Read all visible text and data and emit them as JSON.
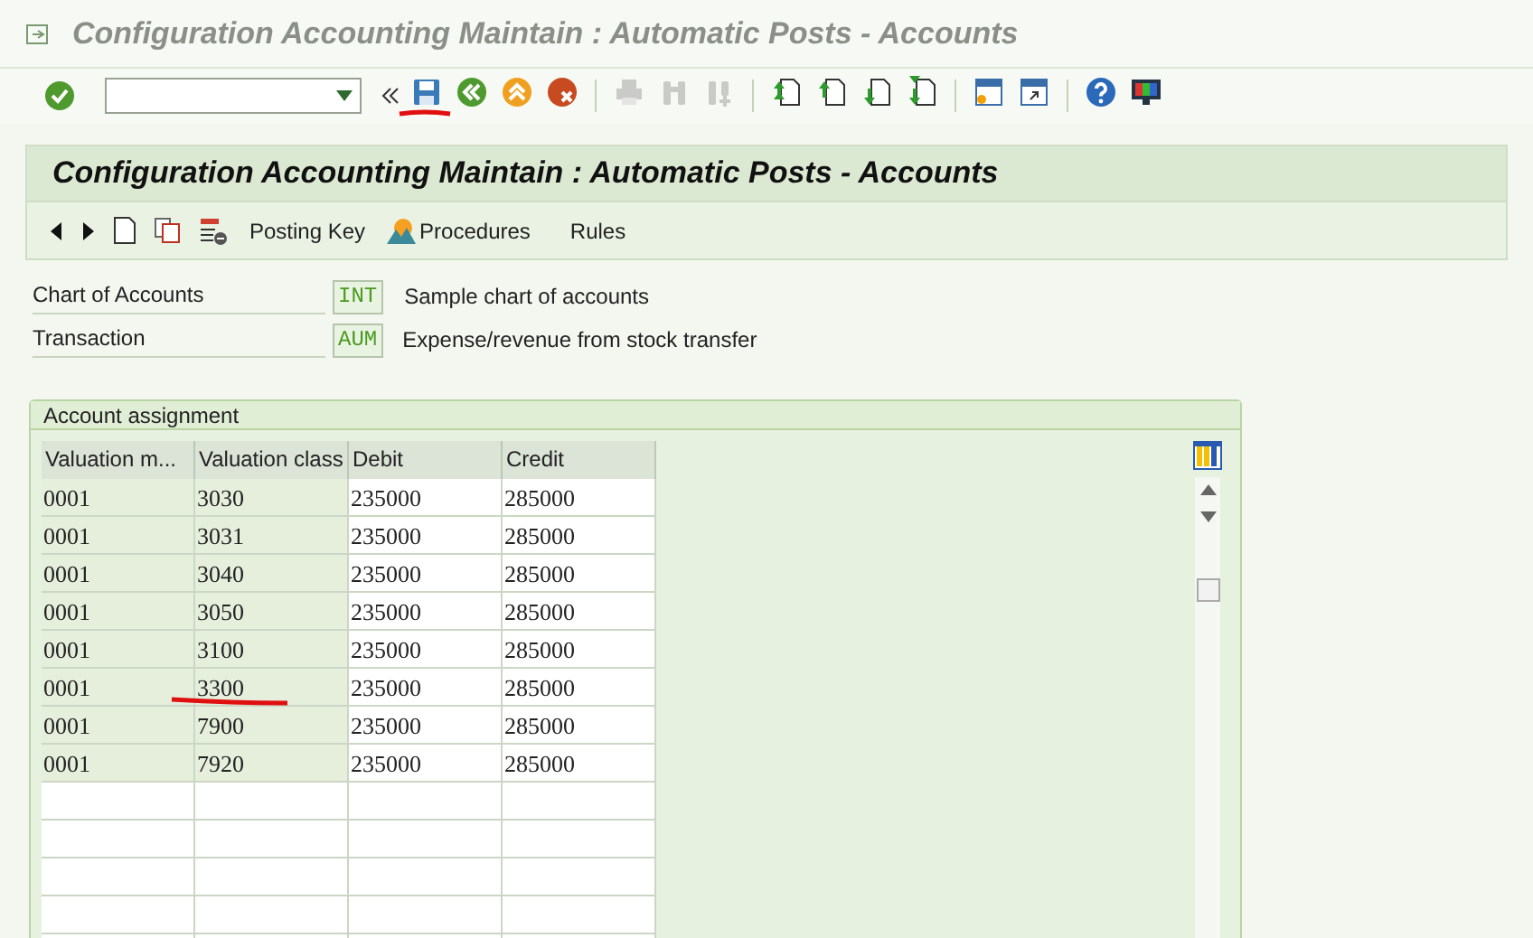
{
  "window": {
    "title": "Configuration Accounting Maintain : Automatic Posts - Accounts"
  },
  "system_toolbar": {
    "buttons": [
      {
        "disabled": false
      },
      {
        "disabled": false
      },
      {
        "disabled": false
      },
      {
        "disabled": false
      },
      {
        "disabled": false
      },
      {
        "disabled": true
      },
      {
        "disabled": true
      },
      {
        "disabled": true
      },
      {
        "disabled": false
      },
      {
        "disabled": false
      },
      {
        "disabled": false
      },
      {
        "disabled": false
      },
      {
        "disabled": false
      },
      {
        "disabled": false
      },
      {
        "disabled": false
      },
      {
        "disabled": false
      }
    ]
  },
  "screen_title": "Configuration Accounting Maintain : Automatic Posts - Accounts",
  "app_toolbar": {
    "buttons": [
      {
        "label": "Posting Key"
      },
      {
        "label": "Procedures"
      },
      {
        "label": "Rules"
      }
    ]
  },
  "fields": [
    {
      "label": "Chart of Accounts",
      "value": "INT",
      "description": "Sample chart of accounts"
    },
    {
      "label": "Transaction",
      "value": "AUM",
      "description": "Expense/revenue from stock transfer"
    }
  ],
  "group": {
    "title": "Account assignment"
  },
  "table": {
    "columns": [
      "Valuation m...",
      "Valuation class",
      "Debit",
      "Credit"
    ],
    "rows": [
      [
        "0001",
        "3030",
        "235000",
        "285000"
      ],
      [
        "0001",
        "3031",
        "235000",
        "285000"
      ],
      [
        "0001",
        "3040",
        "235000",
        "285000"
      ],
      [
        "0001",
        "3050",
        "235000",
        "285000"
      ],
      [
        "0001",
        "3100",
        "235000",
        "285000"
      ],
      [
        "0001",
        "3300",
        "235000",
        "285000"
      ],
      [
        "0001",
        "7900",
        "235000",
        "285000"
      ],
      [
        "0001",
        "7920",
        "235000",
        "285000"
      ]
    ]
  }
}
